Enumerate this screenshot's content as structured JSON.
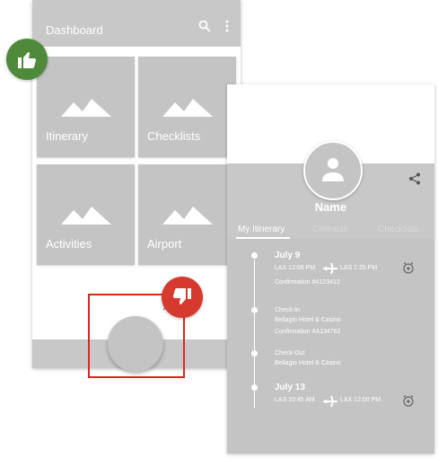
{
  "dashboard": {
    "title": "Dashboard",
    "tiles": [
      {
        "label": "Itinerary"
      },
      {
        "label": "Checklists"
      },
      {
        "label": "Activities"
      },
      {
        "label": "Airport"
      }
    ]
  },
  "profile": {
    "name": "Name",
    "tabs": [
      "My Itinerary",
      "Contacts",
      "Checklists"
    ],
    "active_tab": "My Itinerary",
    "entries": [
      {
        "date": "July 9",
        "from": "LAX 12:06 PM",
        "to": "LAS 1:25 PM",
        "confirmation": "Confirmation #4123412"
      },
      {
        "label": "Check-In",
        "place": "Bellagio Hotel & Casino",
        "confirmation": "Confirmation #A134762"
      },
      {
        "label": "Check-Out",
        "place": "Bellagio Hotel & Casino"
      },
      {
        "date": "July 13",
        "from": "LAS 10:45 AM",
        "to": "LAX 12:00 PM"
      }
    ]
  },
  "annotations": {
    "thumbs_up_color": "#4f8a3b",
    "thumbs_down_color": "#d63a2f",
    "highlight_color": "#e0261f"
  }
}
